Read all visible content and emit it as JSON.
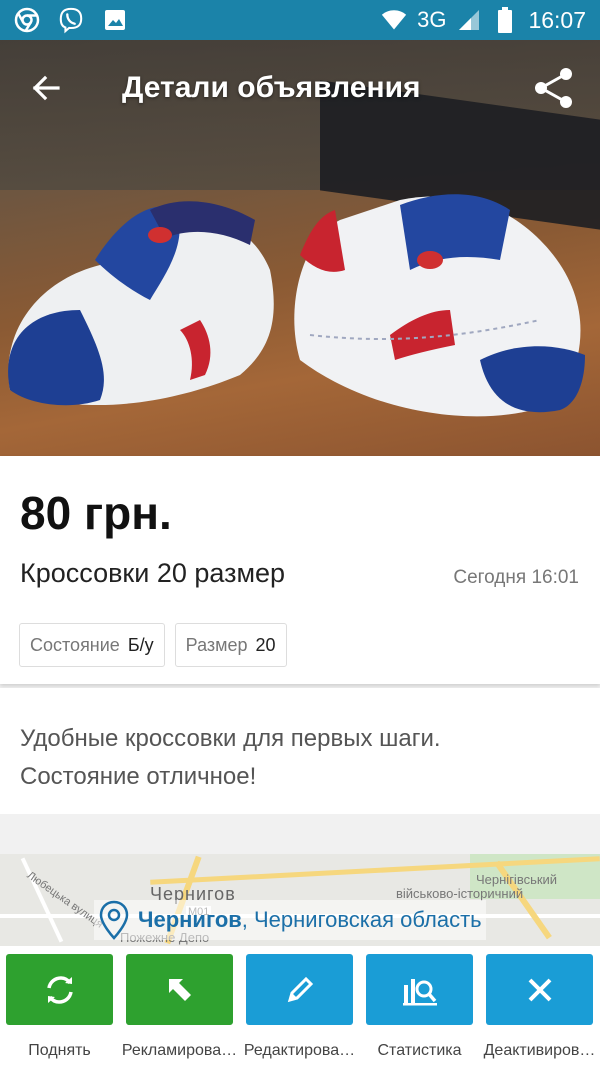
{
  "status_bar": {
    "time": "16:07",
    "network": "3G",
    "icons": [
      "chrome-icon",
      "viber-icon",
      "gallery-icon",
      "wifi-icon",
      "signal-icon",
      "battery-icon"
    ]
  },
  "header": {
    "title": "Детали объявления",
    "back_icon": "arrow-left-icon",
    "share_icon": "share-icon"
  },
  "gallery": {
    "image_count": 2,
    "active_index": 0
  },
  "ad": {
    "price": "80 грн.",
    "title": "Кроссовки 20 размер",
    "date": "Сегодня 16:01",
    "params": [
      {
        "key": "Состояние",
        "value": "Б/у"
      },
      {
        "key": "Размер",
        "value": "20"
      }
    ],
    "description_lines": [
      "Удобные кроссовки для первых шаги.",
      "Состояние отличное!"
    ]
  },
  "map": {
    "labels": {
      "city_map": "Чернигов",
      "museum": "Чернігівський",
      "museum2": "військово-історичний",
      "street": "Любецька вулиця",
      "depot": "Пожежне Депо",
      "road_code": "М01"
    },
    "location_city": "Чернигов",
    "location_region": ", Черниговская область"
  },
  "actions": [
    {
      "label": "Поднять",
      "icon": "refresh-icon",
      "color": "#2ea12f"
    },
    {
      "label": "Рекламирова…",
      "icon": "arrow-up-left-icon",
      "color": "#2ea12f"
    },
    {
      "label": "Редактирова…",
      "icon": "pencil-icon",
      "color": "#1a9dd6"
    },
    {
      "label": "Статистика",
      "icon": "statistics-icon",
      "color": "#1a9dd6"
    },
    {
      "label": "Деактивиров…",
      "icon": "close-icon",
      "color": "#1a9dd6"
    }
  ],
  "colors": {
    "status_bar": "#1b83a9",
    "green": "#2ea12f",
    "blue": "#1a9dd6",
    "link": "#1b6fa8"
  }
}
